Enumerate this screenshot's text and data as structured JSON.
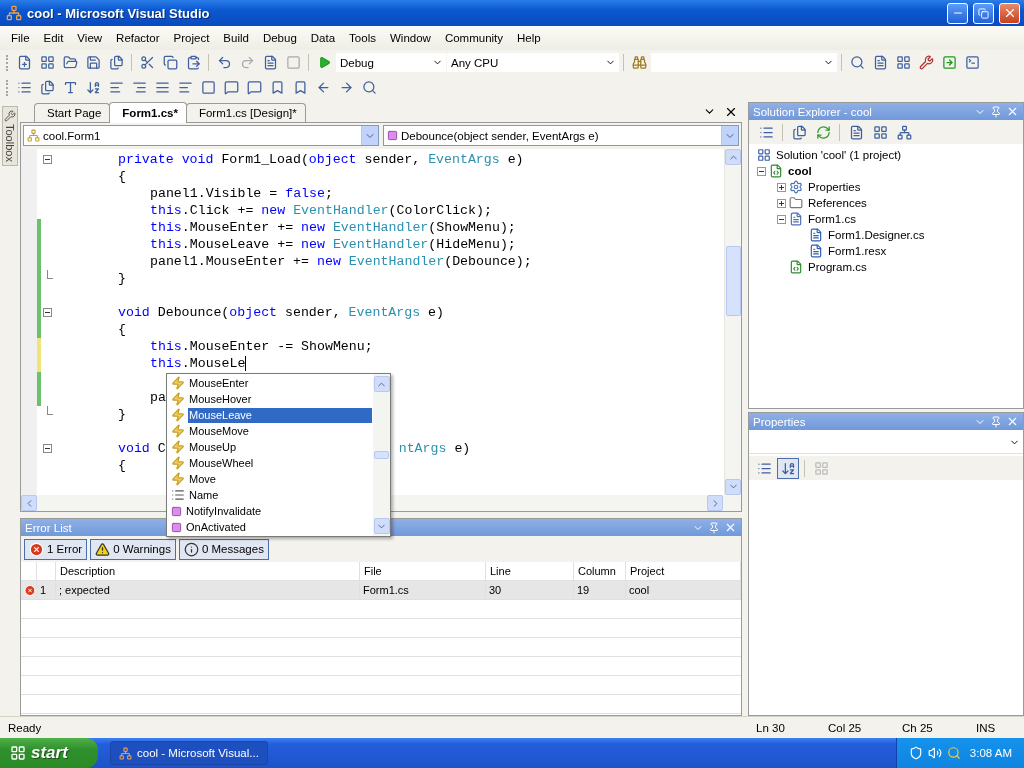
{
  "window": {
    "title": "cool - Microsoft Visual Studio"
  },
  "menu": [
    "File",
    "Edit",
    "View",
    "Refactor",
    "Project",
    "Build",
    "Debug",
    "Data",
    "Tools",
    "Window",
    "Community",
    "Help"
  ],
  "toolbar": {
    "configuration": "Debug",
    "platform": "Any CPU"
  },
  "toolbox": {
    "label": "Toolbox"
  },
  "editor": {
    "tabs": [
      {
        "label": "Start Page",
        "selected": false
      },
      {
        "label": "Form1.cs*",
        "selected": true
      },
      {
        "label": "Form1.cs [Design]*",
        "selected": false
      }
    ],
    "type_selector": "cool.Form1",
    "member_selector": "Debounce(object sender, EventArgs e)",
    "lines": [
      {
        "kind": "code",
        "collapsed": false,
        "tokens": [
          {
            "text": "private ",
            "kind": "keyword"
          },
          {
            "text": "void",
            "kind": "keyword"
          },
          {
            "text": " Form1_Load(",
            "kind": "text"
          },
          {
            "text": "object",
            "kind": "keyword"
          },
          {
            "text": " sender, ",
            "kind": "text"
          },
          {
            "text": "EventArgs",
            "kind": "type"
          },
          {
            "text": " e)",
            "kind": "text"
          }
        ]
      },
      {
        "kind": "code",
        "tokens": [
          {
            "text": "{",
            "kind": "text"
          }
        ],
        "children": [
          {
            "kind": "code",
            "tokens": [
              {
                "text": "panel1.Visible = ",
                "kind": "text"
              },
              {
                "text": "false",
                "kind": "keyword"
              },
              {
                "text": ";",
                "kind": "text"
              }
            ]
          },
          {
            "kind": "code",
            "tokens": [
              {
                "text": "this",
                "kind": "keyword"
              },
              {
                "text": ".Click += ",
                "kind": "text"
              },
              {
                "text": "new ",
                "kind": "keyword"
              },
              {
                "text": "EventHandler",
                "kind": "type"
              },
              {
                "text": "(ColorClick);",
                "kind": "text"
              }
            ]
          },
          {
            "kind": "code",
            "modified": true,
            "saved": true,
            "tokens": [
              {
                "text": "this",
                "kind": "keyword"
              },
              {
                "text": ".MouseEnter += ",
                "kind": "text"
              },
              {
                "text": "new ",
                "kind": "keyword"
              },
              {
                "text": "EventHandler",
                "kind": "type"
              },
              {
                "text": "(ShowMenu);",
                "kind": "text"
              }
            ]
          },
          {
            "kind": "code",
            "modified": true,
            "saved": true,
            "tokens": [
              {
                "text": "this",
                "kind": "keyword"
              },
              {
                "text": ".MouseLeave += ",
                "kind": "text"
              },
              {
                "text": "new ",
                "kind": "keyword"
              },
              {
                "text": "EventHandler",
                "kind": "type"
              },
              {
                "text": "(HideMenu);",
                "kind": "text"
              }
            ]
          },
          {
            "kind": "code",
            "modified": true,
            "saved": true,
            "tokens": [
              {
                "text": "panel1.MouseEnter += ",
                "kind": "text"
              },
              {
                "text": "new ",
                "kind": "keyword"
              },
              {
                "text": "EventHandler",
                "kind": "type"
              },
              {
                "text": "(Debounce);",
                "kind": "text"
              }
            ]
          }
        ]
      },
      {
        "kind": "code",
        "block_end": true,
        "modified": true,
        "saved": true,
        "tokens": [
          {
            "text": "}",
            "kind": "text"
          }
        ]
      },
      {
        "kind": "blank",
        "modified": true,
        "saved": true
      },
      {
        "kind": "code",
        "collapsed": false,
        "modified": true,
        "saved": true,
        "tokens": [
          {
            "text": "void",
            "kind": "keyword"
          },
          {
            "text": " Debounce(",
            "kind": "text"
          },
          {
            "text": "object",
            "kind": "keyword"
          },
          {
            "text": " sender, ",
            "kind": "text"
          },
          {
            "text": "EventArgs",
            "kind": "type"
          },
          {
            "text": " e)",
            "kind": "text"
          }
        ]
      },
      {
        "kind": "code",
        "modified": true,
        "saved": true,
        "tokens": [
          {
            "text": "{",
            "kind": "text"
          }
        ],
        "children": [
          {
            "kind": "code",
            "modified": true,
            "saved": false,
            "tokens": [
              {
                "text": "this",
                "kind": "keyword"
              },
              {
                "text": ".MouseEnter -= ShowMenu;",
                "kind": "text"
              }
            ]
          },
          {
            "kind": "code",
            "modified": true,
            "saved": false,
            "caret": true,
            "tokens": [
              {
                "text": "this",
                "kind": "keyword"
              },
              {
                "text": ".MouseLe",
                "kind": "text"
              }
            ]
          },
          {
            "kind": "blank",
            "modified": true,
            "saved": true
          },
          {
            "kind": "code",
            "modified": true,
            "saved": true,
            "tokens": [
              {
                "text": "pa",
                "kind": "text"
              }
            ]
          }
        ]
      },
      {
        "kind": "code",
        "block_end": true,
        "tokens": [
          {
            "text": "}",
            "kind": "text"
          }
        ]
      },
      {
        "kind": "blank"
      },
      {
        "kind": "code",
        "collapsed": false,
        "tokens": [
          {
            "text": "void",
            "kind": "keyword"
          },
          {
            "text": " C",
            "kind": "text"
          }
        ],
        "after_popup": [
          {
            "text": "ntArgs",
            "kind": "type"
          },
          {
            "text": " e)",
            "kind": "text"
          }
        ]
      },
      {
        "kind": "code",
        "tokens": [
          {
            "text": "{",
            "kind": "text"
          }
        ]
      }
    ],
    "popup": {
      "items": [
        {
          "label": "MouseEnter",
          "kind": "event",
          "selected": false
        },
        {
          "label": "MouseHover",
          "kind": "event",
          "selected": false
        },
        {
          "label": "MouseLeave",
          "kind": "event",
          "selected": true
        },
        {
          "label": "MouseMove",
          "kind": "event",
          "selected": false
        },
        {
          "label": "MouseUp",
          "kind": "event",
          "selected": false
        },
        {
          "label": "MouseWheel",
          "kind": "event",
          "selected": false
        },
        {
          "label": "Move",
          "kind": "event",
          "selected": false
        },
        {
          "label": "Name",
          "kind": "property",
          "selected": false
        },
        {
          "label": "NotifyInvalidate",
          "kind": "method",
          "selected": false
        },
        {
          "label": "OnActivated",
          "kind": "method",
          "selected": false
        }
      ]
    }
  },
  "error_list": {
    "title": "Error List",
    "filters": [
      {
        "label": "1 Error",
        "kind": "error",
        "on": true
      },
      {
        "label": "0 Warnings",
        "kind": "warning",
        "on": true
      },
      {
        "label": "0 Messages",
        "kind": "message",
        "on": true
      }
    ],
    "columns": [
      "Description",
      "File",
      "Line",
      "Column",
      "Project"
    ],
    "rows": [
      {
        "kind": "error",
        "number": "1",
        "description": "; expected",
        "file": "Form1.cs",
        "line": "30",
        "column": "19",
        "project": "cool"
      }
    ]
  },
  "solution_explorer": {
    "title": "Solution Explorer - cool",
    "tree": [
      {
        "label": "Solution 'cool' (1 project)",
        "kind": "solution",
        "children": [
          {
            "label": "cool",
            "kind": "project",
            "expanded": true,
            "children": [
              {
                "label": "Properties",
                "kind": "properties",
                "expanded": false
              },
              {
                "label": "References",
                "kind": "references",
                "expanded": false
              },
              {
                "label": "Form1.cs",
                "kind": "form",
                "expanded": true,
                "children": [
                  {
                    "label": "Form1.Designer.cs",
                    "kind": "file"
                  },
                  {
                    "label": "Form1.resx",
                    "kind": "file"
                  }
                ]
              },
              {
                "label": "Program.cs",
                "kind": "csharp"
              }
            ]
          }
        ]
      }
    ]
  },
  "properties": {
    "title": "Properties"
  },
  "status_bar": {
    "message": "Ready",
    "line": "Ln 30",
    "column": "Col 25",
    "char": "Ch 25",
    "mode": "INS"
  },
  "taskbar": {
    "start": "start",
    "tasks": [
      "cool - Microsoft Visual..."
    ],
    "clock": "3:08 AM"
  }
}
